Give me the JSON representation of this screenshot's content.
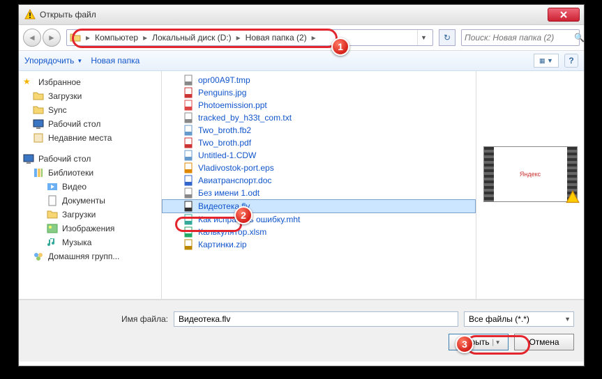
{
  "window": {
    "title": "Открыть файл"
  },
  "breadcrumbs": [
    "Компьютер",
    "Локальный диск (D:)",
    "Новая папка (2)"
  ],
  "search": {
    "placeholder": "Поиск: Новая папка (2)"
  },
  "toolbar": {
    "organize": "Упорядочить",
    "new_folder": "Новая папка",
    "help": "?"
  },
  "sidebar": {
    "favorites": {
      "label": "Избранное",
      "items": [
        "Загрузки",
        "Sync",
        "Рабочий стол",
        "Недавние места"
      ]
    },
    "desktop": {
      "label": "Рабочий стол"
    },
    "libraries": {
      "label": "Библиотеки",
      "items": [
        "Видео",
        "Документы",
        "Загрузки",
        "Изображения",
        "Музыка"
      ]
    },
    "homegroup": {
      "label": "Домашняя групп..."
    }
  },
  "files": [
    {
      "name": "opr00A9T.tmp",
      "type": "tmp"
    },
    {
      "name": "Penguins.jpg",
      "type": "jpg"
    },
    {
      "name": "Photoemission.ppt",
      "type": "ppt"
    },
    {
      "name": "tracked_by_h33t_com.txt",
      "type": "txt"
    },
    {
      "name": "Two_broth.fb2",
      "type": "fb2"
    },
    {
      "name": "Two_broth.pdf",
      "type": "pdf"
    },
    {
      "name": "Untitled-1.CDW",
      "type": "cdw"
    },
    {
      "name": "Vladivostok-port.eps",
      "type": "eps"
    },
    {
      "name": "Авиатранспорт.doc",
      "type": "doc"
    },
    {
      "name": "Без имени 1.odt",
      "type": "odt"
    },
    {
      "name": "Видеотека.flv",
      "type": "flv",
      "selected": true
    },
    {
      "name": "Как исправить ошибку.mht",
      "type": "mht"
    },
    {
      "name": "Калькулятор.xlsm",
      "type": "xlsm"
    },
    {
      "name": "Картинки.zip",
      "type": "zip"
    }
  ],
  "preview": {
    "label": "Яндекс"
  },
  "footer": {
    "filename_label": "Имя файла:",
    "filename_value": "Видеотека.flv",
    "filter": "Все файлы (*.*)",
    "open": "Открыть",
    "cancel": "Отмена"
  },
  "markers": {
    "m1": "1",
    "m2": "2",
    "m3": "3"
  }
}
